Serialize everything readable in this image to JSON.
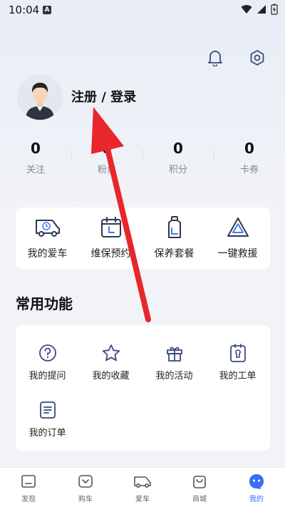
{
  "status_bar": {
    "time": "10:04",
    "app_indicator": "A"
  },
  "header": {
    "notification_icon": "bell-icon",
    "settings_icon": "hexagon-settings-icon"
  },
  "profile": {
    "login_label": "注册 / 登录"
  },
  "stats": [
    {
      "value": "0",
      "label": "关注"
    },
    {
      "value": "0",
      "label": "粉丝"
    },
    {
      "value": "0",
      "label": "积分"
    },
    {
      "value": "0",
      "label": "卡券"
    }
  ],
  "quick_actions": [
    {
      "label": "我的爱车",
      "icon": "van-icon"
    },
    {
      "label": "维保预约",
      "icon": "calendar-icon"
    },
    {
      "label": "保养套餐",
      "icon": "oil-bottle-icon"
    },
    {
      "label": "一键救援",
      "icon": "warning-triangle-icon"
    }
  ],
  "common_functions": {
    "title": "常用功能",
    "items": [
      {
        "label": "我的提问",
        "icon": "question-icon"
      },
      {
        "label": "我的收藏",
        "icon": "star-icon"
      },
      {
        "label": "我的活动",
        "icon": "gift-icon"
      },
      {
        "label": "我的工单",
        "icon": "work-order-icon"
      },
      {
        "label": "我的订单",
        "icon": "order-list-icon"
      }
    ]
  },
  "tab_bar": [
    {
      "label": "发现",
      "icon": "discover-icon",
      "active": false
    },
    {
      "label": "购车",
      "icon": "buy-car-icon",
      "active": false
    },
    {
      "label": "爱车",
      "icon": "my-car-icon",
      "active": false
    },
    {
      "label": "商城",
      "icon": "shop-bag-icon",
      "active": false
    },
    {
      "label": "我的",
      "icon": "profile-face-icon",
      "active": true
    }
  ],
  "colors": {
    "accent": "#3b6cf5",
    "icon_stroke": "#3a4a7a",
    "annotation_arrow": "#e8262b"
  }
}
